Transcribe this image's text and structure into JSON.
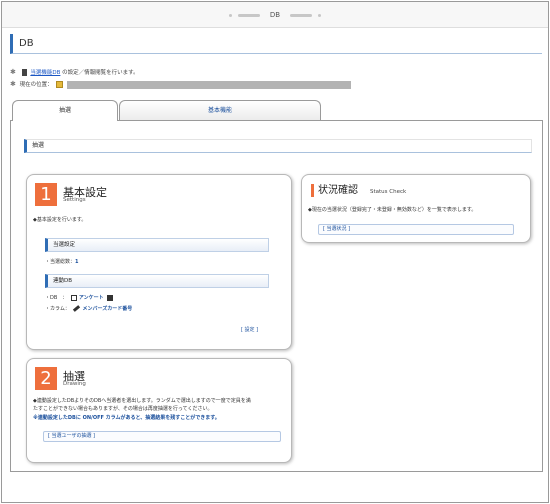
{
  "window": {
    "title": "DB"
  },
  "header": {
    "title": "DB"
  },
  "info": {
    "line1_link": "当選機能DB",
    "line1_text": "の設定／情報閲覧を行います。",
    "location_label": "現在の位置："
  },
  "tabs": [
    {
      "label": "抽選",
      "active": true
    },
    {
      "label": "基本機能",
      "active": false
    }
  ],
  "section": {
    "title": "抽選"
  },
  "basic_card": {
    "number": "1",
    "title": "基本設定",
    "subtitle": "Settings",
    "desc": "◆基本設定を行います。",
    "winners_header": "当選設定",
    "winners_label": "・当選総数：",
    "winners_value": "1",
    "link_db_header": "連動DB",
    "db_label": "・DB　：",
    "db_value": "アンケート",
    "column_label": "・カラム：",
    "column_value": "メンバーズカード番号",
    "settings_link": "[ 設定 ]"
  },
  "draw_card": {
    "number": "2",
    "title": "抽選",
    "subtitle": "Drawing",
    "desc_line1": "◆連動設定したDBよりそのDBへ当選者を選出します。ランダムで選出しますので一度で定員を満",
    "desc_line2": "たすことができない場合もありますが、その場合は再度抽選を行ってください。",
    "notice": "※連動設定したDBに ON/OFF カラムがあると、抽選結果を残すことができます。",
    "draw_link": "[ 当選ユーザの抽選 ]"
  },
  "status_card": {
    "title": "状況確認",
    "subtitle": "Status Check",
    "desc": "◆現在の当選状況（登録完了・未登録・無効数など）を一覧で表示します。",
    "status_link": "[ 当選状況 ]"
  },
  "colors": {
    "accent": "#2f6db5",
    "number_bg": "#ee6f3c",
    "link": "#1a4f9c"
  }
}
